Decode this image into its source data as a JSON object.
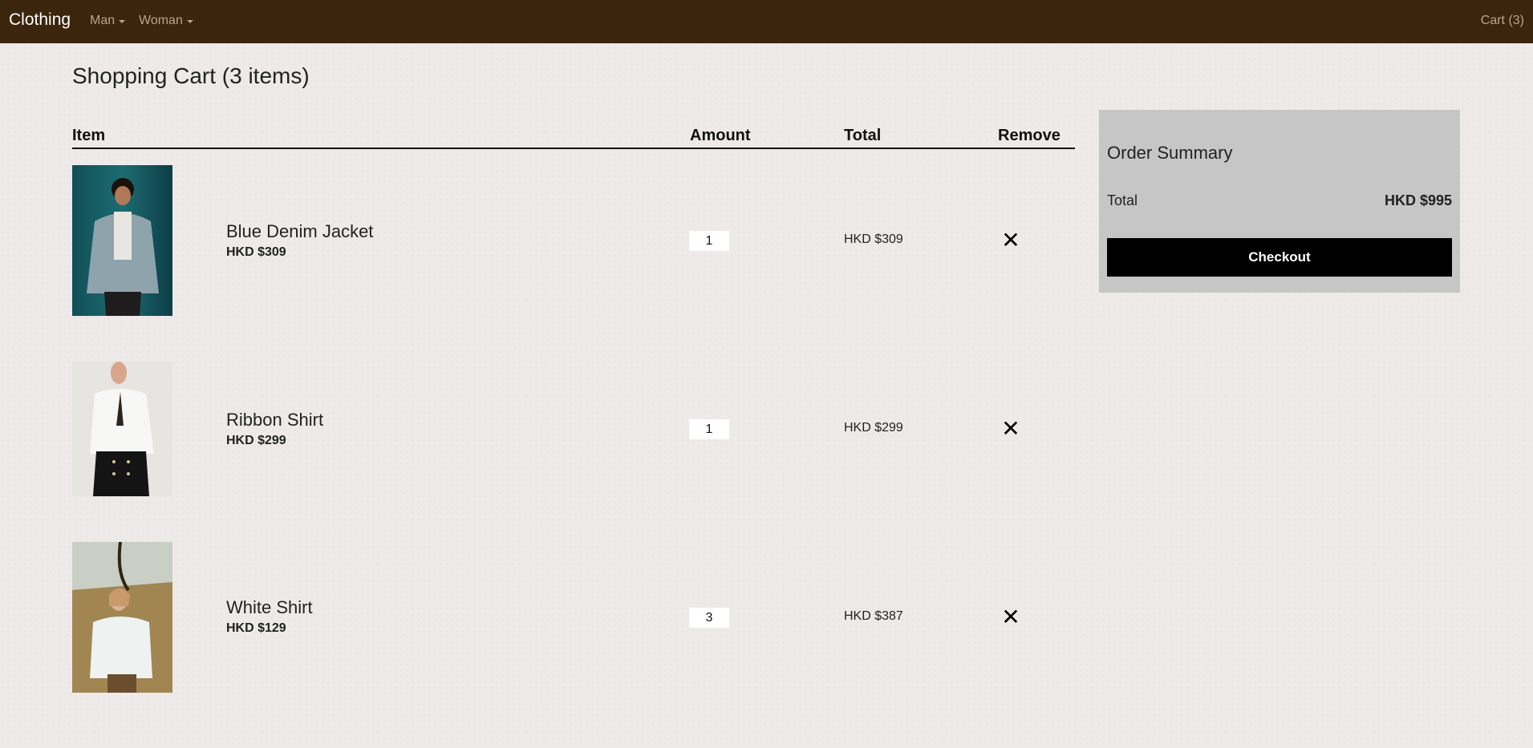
{
  "navbar": {
    "brand": "Clothing",
    "menu": [
      {
        "label": "Man"
      },
      {
        "label": "Woman"
      }
    ],
    "cart_label": "Cart (3)"
  },
  "page": {
    "title": "Shopping Cart (3 items)"
  },
  "cart_table": {
    "headers": {
      "item": "Item",
      "amount": "Amount",
      "total": "Total",
      "remove": "Remove"
    },
    "rows": [
      {
        "name": "Blue Denim Jacket",
        "unit_price": "HKD $309",
        "quantity": "1",
        "line_total": "HKD $309",
        "image": "man-in-denim-jacket-photo"
      },
      {
        "name": "Ribbon Shirt",
        "unit_price": "HKD $299",
        "quantity": "1",
        "line_total": "HKD $299",
        "image": "woman-in-ribbon-shirt-photo"
      },
      {
        "name": "White Shirt",
        "unit_price": "HKD $129",
        "quantity": "3",
        "line_total": "HKD $387",
        "image": "woman-in-white-shirt-photo"
      }
    ],
    "remove_icon": "close-icon"
  },
  "summary": {
    "title": "Order Summary",
    "total_label": "Total",
    "total_value": "HKD $995",
    "checkout_label": "Checkout"
  },
  "colors": {
    "navbar_bg": "#3b250c",
    "page_bg": "#eeeaea",
    "summary_bg": "#c6c6c6",
    "checkout_bg": "#000000",
    "nav_link": "#b8a58e"
  }
}
